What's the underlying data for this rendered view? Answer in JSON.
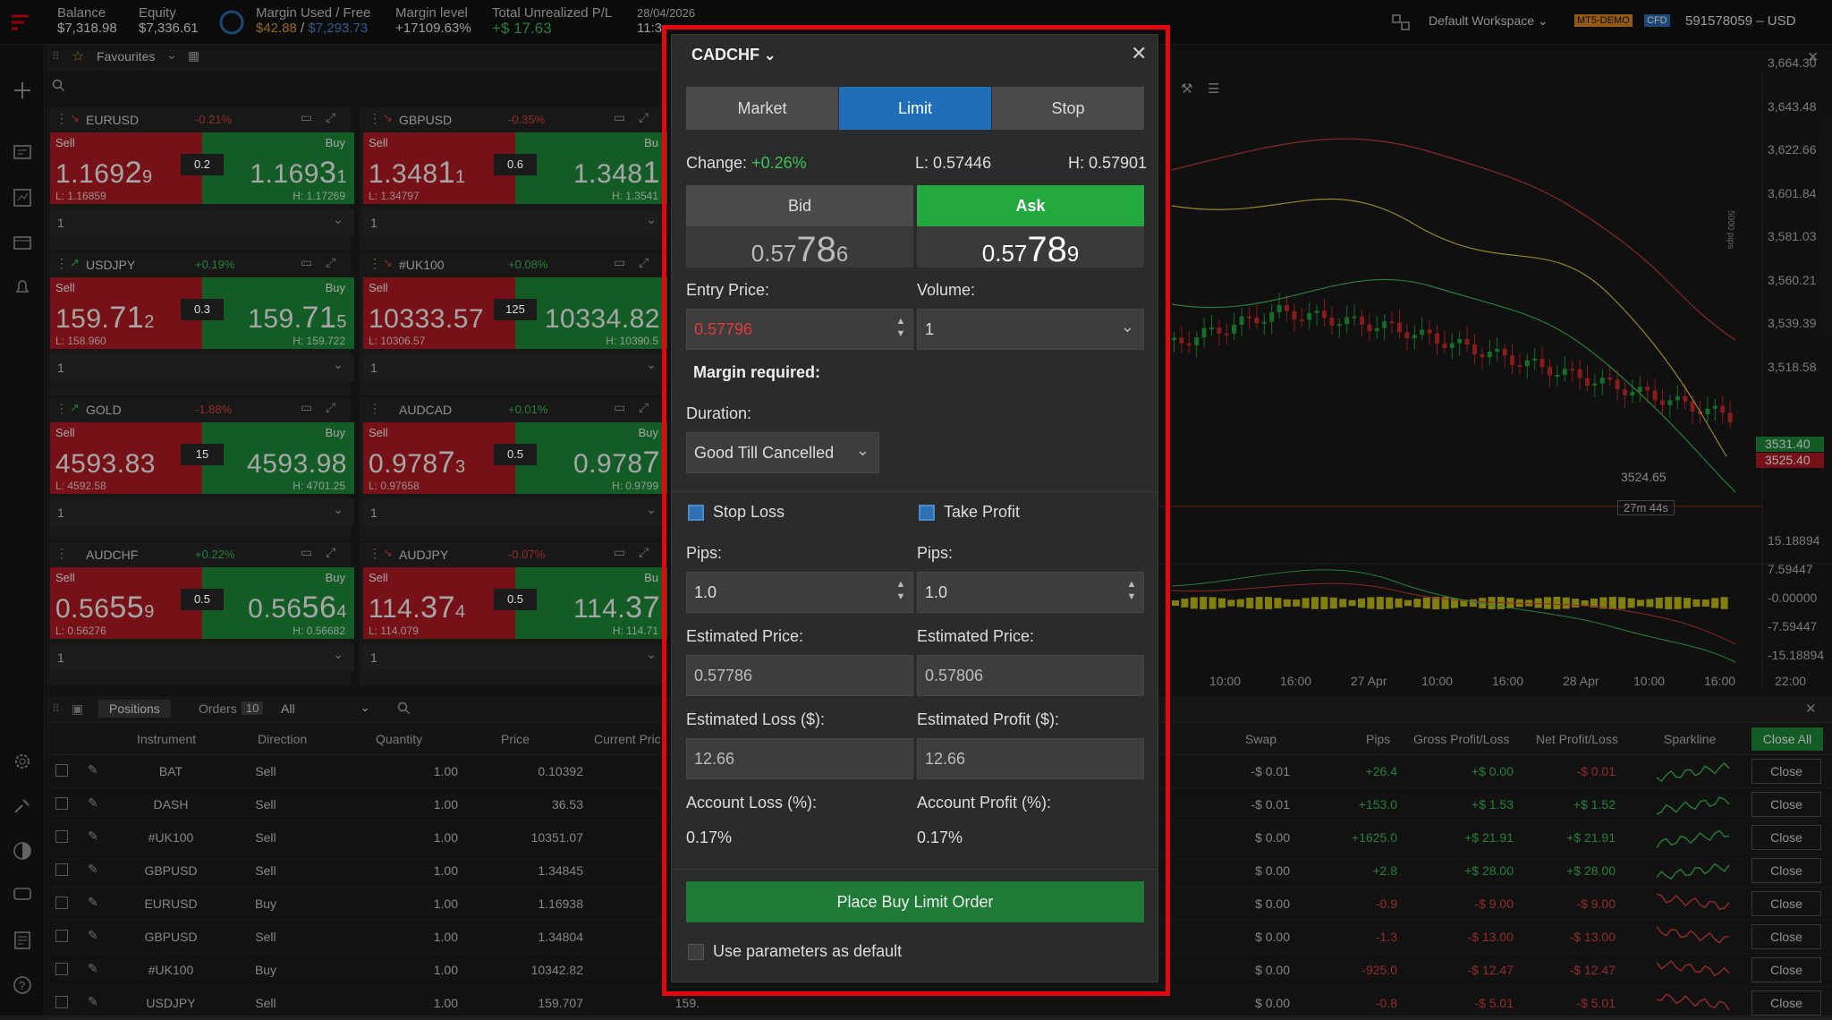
{
  "topbar": {
    "balance_label": "Balance",
    "balance": "$7,318.98",
    "equity_label": "Equity",
    "equity": "$7,336.61",
    "margin_label": "Margin Used / Free",
    "margin_used": "$42.88",
    "margin_sep": " / ",
    "margin_free": "$7,293.73",
    "level_label": "Margin level",
    "level": "+17109.63%",
    "pl_label": "Total Unrealized P/L",
    "pl": "+$ 17.63",
    "date": "28/04/2026",
    "time": "11:3",
    "workspace": "Default Workspace",
    "account_badge": "MT5-DEMO",
    "cfd_badge": "CFD",
    "account": "591578059 – USD"
  },
  "fav": {
    "title": "Favourites"
  },
  "tiles": [
    {
      "symbol": "EURUSD",
      "change": "-0.21%",
      "sell_label": "Sell",
      "buy_label": "Buy",
      "sell_a": "1.169",
      "sell_b": "2",
      "sell_c": "9",
      "buy_a": "1.169",
      "buy_b": "3",
      "buy_c": "1",
      "spread": "0.2",
      "low": "L: 1.16859",
      "high": "H: 1.17269",
      "qty": "1",
      "dir": "down"
    },
    {
      "symbol": "GBPUSD",
      "change": "-0.35%",
      "sell_label": "Sell",
      "buy_label": "Bu",
      "sell_a": "1.348",
      "sell_b": "1",
      "sell_c": "1",
      "buy_a": "1.348",
      "buy_b": "1",
      "buy_c": "",
      "spread": "0.6",
      "low": "L: 1.34797",
      "high": "H: 1.3541",
      "qty": "1",
      "dir": "down"
    },
    {
      "symbol": "USDJPY",
      "change": "+0.19%",
      "sell_label": "Sell",
      "buy_label": "Buy",
      "sell_a": "159.",
      "sell_b": "71",
      "sell_c": "2",
      "buy_a": "159.",
      "buy_b": "71",
      "buy_c": "5",
      "spread": "0.3",
      "low": "L: 158.960",
      "high": "H: 159.722",
      "qty": "1",
      "dir": "up"
    },
    {
      "symbol": "#UK100",
      "change": "+0.08%",
      "sell_label": "Sell",
      "buy_label": "",
      "sell_a": "10333.57",
      "sell_b": "",
      "sell_c": "",
      "buy_a": "10334.82",
      "buy_b": "",
      "buy_c": "",
      "spread": "125",
      "low": "L: 10306.57",
      "high": "H: 10390.5",
      "qty": "1",
      "dir": "down"
    },
    {
      "symbol": "GOLD",
      "change": "-1.88%",
      "sell_label": "Sell",
      "buy_label": "Buy",
      "sell_a": "4593.83",
      "sell_b": "",
      "sell_c": "",
      "buy_a": "4593.98",
      "buy_b": "",
      "buy_c": "",
      "spread": "15",
      "low": "L: 4592.58",
      "high": "H: 4701.25",
      "qty": "1",
      "dir": "up"
    },
    {
      "symbol": "AUDCAD",
      "change": "+0.01%",
      "sell_label": "Sell",
      "buy_label": "Buy",
      "sell_a": "0.978",
      "sell_b": "7",
      "sell_c": "3",
      "buy_a": "0.978",
      "buy_b": "7",
      "buy_c": "",
      "spread": "0.5",
      "low": "L: 0.97658",
      "high": "H: 0.9799",
      "qty": "1",
      "dir": "none"
    },
    {
      "symbol": "AUDCHF",
      "change": "+0.22%",
      "sell_label": "Sell",
      "buy_label": "Buy",
      "sell_a": "0.56",
      "sell_b": "55",
      "sell_c": "9",
      "buy_a": "0.56",
      "buy_b": "56",
      "buy_c": "4",
      "spread": "0.5",
      "low": "L: 0.56276",
      "high": "H: 0.56682",
      "qty": "1",
      "dir": "none"
    },
    {
      "symbol": "AUDJPY",
      "change": "-0.07%",
      "sell_label": "Sell",
      "buy_label": "Bu",
      "sell_a": "114.",
      "sell_b": "37",
      "sell_c": "4",
      "buy_a": "114.",
      "buy_b": "37",
      "buy_c": "",
      "spread": "0.5",
      "low": "L: 114.079",
      "high": "H: 114.71",
      "qty": "1",
      "dir": "down"
    }
  ],
  "chart": {
    "price_labels": [
      "3,664.30",
      "3,643.48",
      "3,622.66",
      "3,601.84",
      "3,581.03",
      "3,560.21",
      "3,539.39",
      "3,518.58"
    ],
    "badge_green": "3531.40",
    "badge_red": "3525.40",
    "low_label": "3524.65",
    "timer": "27m 44s",
    "pips_label": "5000 pips",
    "osc_labels": [
      "15.18894",
      "7.59447",
      "-0.00000",
      "-7.59447",
      "-15.18894"
    ],
    "time_labels": [
      "10:00",
      "16:00",
      "27 Apr",
      "10:00",
      "16:00",
      "28 Apr",
      "10:00",
      "16:00",
      "22:00"
    ]
  },
  "positions": {
    "tab_positions": "Positions",
    "tab_orders": "Orders",
    "count": "10",
    "filter": "All",
    "headers": [
      "Instrument",
      "Direction",
      "Quantity",
      "Price",
      "Current Pric",
      "Swap",
      "Pips",
      "Gross Profit/Loss",
      "Net Profit/Loss",
      "Sparkline"
    ],
    "close_all": "Close All",
    "close_label": "Close",
    "rows": [
      {
        "instrument": "BAT",
        "direction": "Sell",
        "quantity": "1.00",
        "price": "0.10392",
        "current": "0.1",
        "swap": "-$ 0.01",
        "pips": "+26.4",
        "gross": "+$ 0.00",
        "net": "-$ 0.01",
        "dir": "up"
      },
      {
        "instrument": "DASH",
        "direction": "Sell",
        "quantity": "1.00",
        "price": "36.53",
        "current": "3",
        "swap": "-$ 0.01",
        "pips": "+153.0",
        "gross": "+$ 1.53",
        "net": "+$ 1.52",
        "dir": "up"
      },
      {
        "instrument": "#UK100",
        "direction": "Sell",
        "quantity": "1.00",
        "price": "10351.07",
        "current": "1033",
        "swap": "$ 0.00",
        "pips": "+1625.0",
        "gross": "+$ 21.91",
        "net": "+$ 21.91",
        "dir": "up"
      },
      {
        "instrument": "GBPUSD",
        "direction": "Sell",
        "quantity": "1.00",
        "price": "1.34845",
        "current": "1.3",
        "swap": "$ 0.00",
        "pips": "+2.8",
        "gross": "+$ 28.00",
        "net": "+$ 28.00",
        "dir": "up"
      },
      {
        "instrument": "EURUSD",
        "direction": "Buy",
        "quantity": "1.00",
        "price": "1.16938",
        "current": "1.1",
        "swap": "$ 0.00",
        "pips": "-0.9",
        "gross": "-$ 9.00",
        "net": "-$ 9.00",
        "dir": "down"
      },
      {
        "instrument": "GBPUSD",
        "direction": "Sell",
        "quantity": "1.00",
        "price": "1.34804",
        "current": "1.3",
        "swap": "$ 0.00",
        "pips": "-1.3",
        "gross": "-$ 13.00",
        "net": "-$ 13.00",
        "dir": "down"
      },
      {
        "instrument": "#UK100",
        "direction": "Buy",
        "quantity": "1.00",
        "price": "10342.82",
        "current": "1033",
        "swap": "$ 0.00",
        "pips": "-925.0",
        "gross": "-$ 12.47",
        "net": "-$ 12.47",
        "dir": "down"
      },
      {
        "instrument": "USDJPY",
        "direction": "Sell",
        "quantity": "1.00",
        "price": "159.707",
        "current": "159.",
        "swap": "$ 0.00",
        "pips": "-0.8",
        "gross": "-$ 5.01",
        "net": "-$ 5.01",
        "dir": "down"
      }
    ]
  },
  "dialog": {
    "symbol": "CADCHF",
    "tabs": [
      "Market",
      "Limit",
      "Stop"
    ],
    "change_label": "Change:",
    "change": "+0.26%",
    "low": "L: 0.57446",
    "high": "H: 0.57901",
    "bid_label": "Bid",
    "ask_label": "Ask",
    "bid_a": "0.57",
    "bid_b": "78",
    "bid_c": "6",
    "ask_a": "0.57",
    "ask_b": "78",
    "ask_c": "9",
    "entry_label": "Entry Price:",
    "entry_value": "0.57796",
    "volume_label": "Volume:",
    "volume_value": "1",
    "margin_label": "Margin required:",
    "duration_label": "Duration:",
    "duration_value": "Good Till Cancelled",
    "stop_loss_label": "Stop Loss",
    "take_profit_label": "Take Profit",
    "pips_label": "Pips:",
    "sl_pips": "1.0",
    "tp_pips": "1.0",
    "est_price_label": "Estimated Price:",
    "sl_est_price": "0.57786",
    "tp_est_price": "0.57806",
    "est_loss_label": "Estimated Loss ($):",
    "est_profit_label": "Estimated Profit ($):",
    "est_loss": "12.66",
    "est_profit": "12.66",
    "acct_loss_label": "Account Loss (%):",
    "acct_profit_label": "Account Profit (%):",
    "acct_loss": "0.17%",
    "acct_profit": "0.17%",
    "place_button": "Place Buy Limit Order",
    "default_label": "Use parameters as default"
  },
  "colors": {
    "accent_blue": "#1f6fb8",
    "buy_green": "#1e8e3a",
    "sell_red": "#b51d24",
    "frame_red": "#e3060f",
    "ask_green": "#22a83c"
  }
}
